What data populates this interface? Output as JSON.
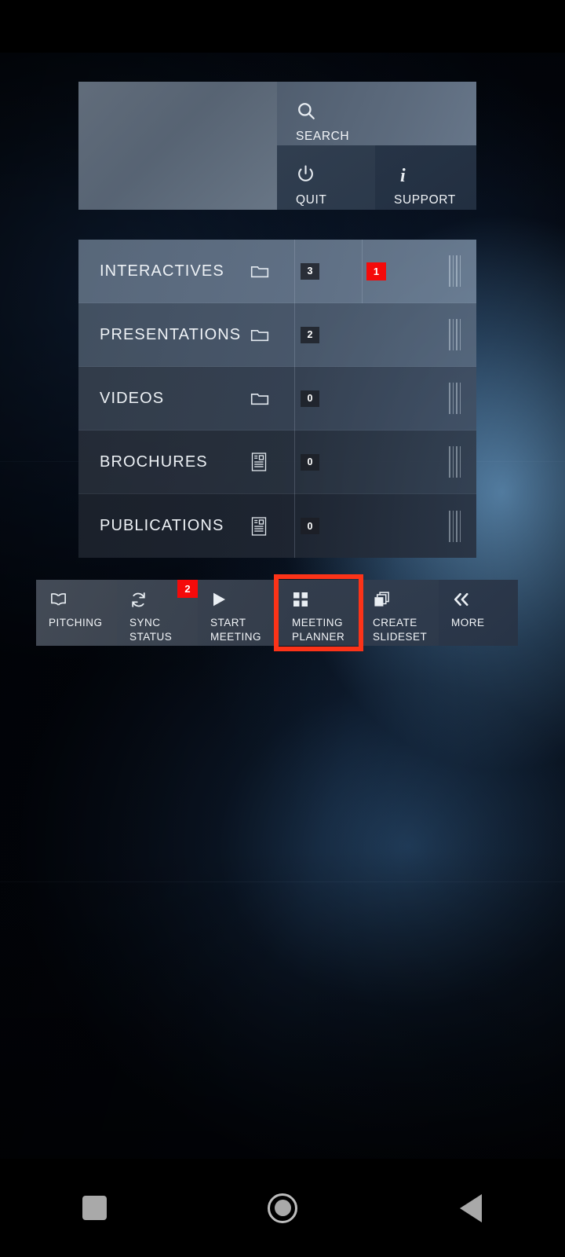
{
  "top_panel": {
    "blank_tile": {
      "label": ""
    },
    "search": {
      "label": "SEARCH",
      "icon": "search-icon"
    },
    "quit": {
      "label": "QUIT",
      "icon": "power-icon"
    },
    "support": {
      "label": "SUPPORT",
      "icon": "info-icon"
    }
  },
  "content_list": {
    "rows": [
      {
        "label": "INTERACTIVES",
        "icon": "folder-icon",
        "count": "3",
        "alert": "1"
      },
      {
        "label": "PRESENTATIONS",
        "icon": "folder-icon",
        "count": "2",
        "alert": ""
      },
      {
        "label": "VIDEOS",
        "icon": "folder-icon",
        "count": "0",
        "alert": ""
      },
      {
        "label": "BROCHURES",
        "icon": "document-icon",
        "count": "0",
        "alert": ""
      },
      {
        "label": "PUBLICATIONS",
        "icon": "document-icon",
        "count": "0",
        "alert": ""
      }
    ]
  },
  "toolbar": {
    "pitching": {
      "label": "PITCHING",
      "icon": "book-icon",
      "badge": ""
    },
    "sync": {
      "label": "SYNC STATUS",
      "icon": "refresh-icon",
      "badge": "2"
    },
    "start": {
      "label": "START\nMEETING",
      "icon": "play-icon",
      "badge": ""
    },
    "meeting": {
      "label": "MEETING\nPLANNER",
      "icon": "grid-icon",
      "badge": ""
    },
    "slideset": {
      "label": "CREATE\nSLIDESET",
      "icon": "layers-icon",
      "badge": ""
    },
    "more": {
      "label": "MORE",
      "icon": "chevron-double-left-icon",
      "badge": ""
    }
  },
  "nav_bar": {
    "recents": "recents-square-icon",
    "home": "home-circle-icon",
    "back": "back-triangle-icon"
  },
  "colors": {
    "alert_red": "#f50a0a",
    "highlight_red": "#fc3318",
    "badge_dark": "#1b1e24",
    "text_light": "#f2f5f8"
  }
}
